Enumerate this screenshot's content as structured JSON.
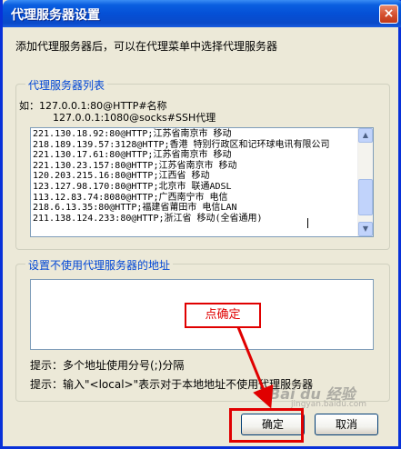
{
  "window": {
    "title": "代理服务器设置",
    "close_label": "×",
    "description": "添加代理服务器后，可以在代理菜单中选择代理服务器"
  },
  "proxy_list": {
    "legend": "代理服务器列表",
    "example_line1": "如：127.0.0.1:80@HTTP#名称",
    "example_line2": "127.0.0.1:1080@socks#SSH代理",
    "entries": [
      "221.130.18.92:80@HTTP;江苏省南京市 移动",
      "218.189.139.57:3128@HTTP;香港 特别行政区和记环球电讯有限公司",
      "221.130.17.61:80@HTTP;江苏省南京市 移动",
      "221.130.23.157:80@HTTP;江苏省南京市 移动",
      "120.203.215.16:80@HTTP;江西省 移动",
      "123.127.98.170:80@HTTP;北京市 联通ADSL",
      "113.12.83.74:8080@HTTP;广西南宁市 电信",
      "218.6.13.35:80@HTTP;福建省莆田市 电信LAN",
      "211.138.124.233:80@HTTP;浙江省 移动(全省通用)"
    ]
  },
  "bypass": {
    "legend": "设置不使用代理服务器的地址",
    "value": "",
    "tip1": "提示：多个地址使用分号(;)分隔",
    "tip2": "提示：输入\"<local>\"表示对于本地地址不使用代理服务器"
  },
  "buttons": {
    "ok": "确定",
    "cancel": "取消"
  },
  "annotation": {
    "callout": "点确定",
    "color": "#e00000"
  },
  "watermark": {
    "text": "Bai du 经验",
    "sub": "jingyan.baidu.com"
  },
  "colors": {
    "titlebar": "#0550d6",
    "legend": "#0046d5",
    "dialog_bg": "#ece9d8"
  },
  "icons": [
    "close-icon",
    "scroll-up-icon",
    "scroll-down-icon"
  ]
}
